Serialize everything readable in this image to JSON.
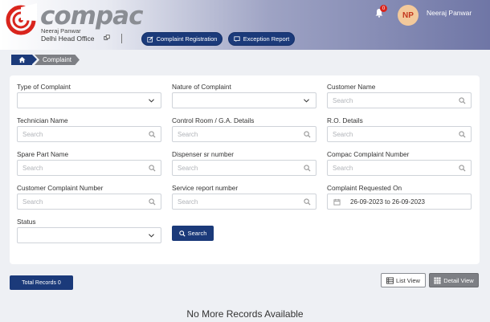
{
  "header": {
    "logo_text": "compac",
    "user_small": "Neeraj Panwar",
    "office": "Delhi Head Office",
    "nav": {
      "complaint_registration": "Complaint Registration",
      "exception_report": "Exception Report"
    },
    "notification_count": "0",
    "avatar_initials": "NP",
    "user_name": "Neeraj Panwar"
  },
  "breadcrumb": {
    "current": "Complaint"
  },
  "form": {
    "type_of_complaint": {
      "label": "Type of Complaint",
      "value": ""
    },
    "nature_of_complaint": {
      "label": "Nature of Complaint",
      "value": ""
    },
    "customer_name": {
      "label": "Customer Name",
      "placeholder": "Search"
    },
    "technician_name": {
      "label": "Technician Name",
      "placeholder": "Search"
    },
    "control_room": {
      "label": "Control Room / G.A. Details",
      "placeholder": "Search"
    },
    "ro_details": {
      "label": "R.O. Details",
      "placeholder": "Search"
    },
    "spare_part_name": {
      "label": "Spare Part Name",
      "placeholder": "Search"
    },
    "dispenser_sr_number": {
      "label": "Dispenser sr number",
      "placeholder": "Search"
    },
    "compac_complaint_number": {
      "label": "Compac Complaint Number",
      "placeholder": "Search"
    },
    "customer_complaint_number": {
      "label": "Customer Complaint Number",
      "placeholder": "Search"
    },
    "service_report_number": {
      "label": "Service report number",
      "placeholder": "Search"
    },
    "complaint_requested_on": {
      "label": "Complaint Requested On",
      "value": "26-09-2023 to 26-09-2023"
    },
    "status": {
      "label": "Status",
      "value": ""
    },
    "search_button": "Search"
  },
  "results": {
    "total_records": "Total Records 0",
    "list_view": "List View",
    "detail_view": "Detail View",
    "empty_message": "No More Records Available"
  },
  "colors": {
    "primary": "#1b3a7a",
    "logo_red": "#d9251d",
    "muted": "#7d7f84"
  }
}
